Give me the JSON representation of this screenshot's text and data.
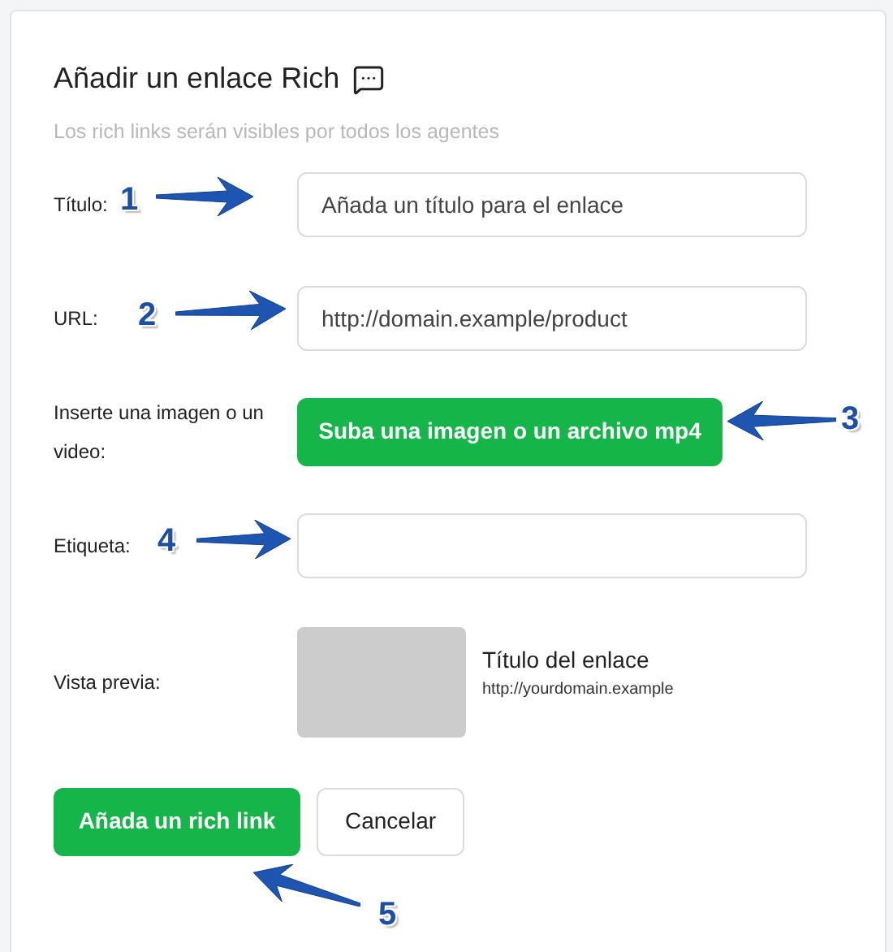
{
  "dialog": {
    "title": "Añadir un enlace Rich",
    "subtitle": "Los rich links serán visibles por todos los agentes"
  },
  "form": [
    {
      "kind": "input",
      "label": "Título:",
      "placeholder": "Añada un título para el enlace"
    },
    {
      "kind": "input",
      "label": "URL:",
      "placeholder": "http://domain.example/product"
    },
    {
      "kind": "upload",
      "label": "Inserte una imagen o un video:",
      "button": "Suba una imagen o un archivo mp4"
    },
    {
      "kind": "input",
      "label": "Etiqueta:"
    },
    {
      "kind": "preview",
      "label": "Vista previa:",
      "preview_title": "Título del enlace",
      "preview_url": "http://yourdomain.example"
    }
  ],
  "buttons": [
    {
      "label": "Añada un rich link",
      "kind": "primary"
    },
    {
      "label": "Cancelar",
      "kind": "secondary"
    }
  ],
  "annotations": [
    {
      "number": "1"
    },
    {
      "number": "2"
    },
    {
      "number": "3"
    },
    {
      "number": "4"
    },
    {
      "number": "5"
    }
  ]
}
